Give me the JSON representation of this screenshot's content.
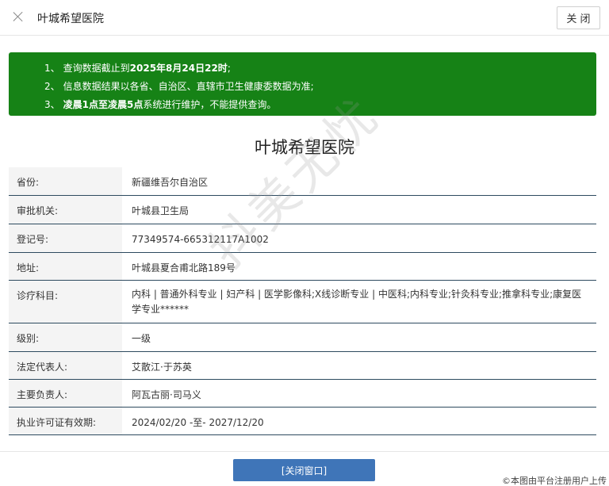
{
  "header": {
    "title": "叶城希望医院",
    "close_label": "关 闭",
    "close_icon": "close-x-icon"
  },
  "notice": {
    "items": [
      {
        "num": "1、",
        "pre": "查询数据截止到",
        "bold": "2025年8月24日22时",
        "post": ";"
      },
      {
        "num": "2、",
        "pre": "信息数据结果以各省、自治区、直辖市卫生健康委数据为准;",
        "bold": "",
        "post": ""
      },
      {
        "num": "3、",
        "pre": "",
        "bold": "凌晨1点至凌晨5点",
        "post": "系统进行维护，不能提供查询。"
      }
    ],
    "bg_color": "#168216"
  },
  "hospital_name": "叶城希望医院",
  "info": {
    "rows": [
      {
        "label": "省份:",
        "value": "新疆维吾尔自治区"
      },
      {
        "label": "审批机关:",
        "value": "叶城县卫生局"
      },
      {
        "label": "登记号:",
        "value": "77349574-665312117A1002"
      },
      {
        "label": "地址:",
        "value": "叶城县夏合甫北路189号"
      },
      {
        "label": "诊疗科目:",
        "value": "内科 | 普通外科专业 | 妇产科 | 医学影像科;X线诊断专业 | 中医科;内科专业;针灸科专业;推拿科专业;康复医学专业******"
      },
      {
        "label": "级别:",
        "value": "一级"
      },
      {
        "label": "法定代表人:",
        "value": "艾散江·于苏英"
      },
      {
        "label": "主要负责人:",
        "value": "阿瓦古丽·司马义"
      },
      {
        "label": "执业许可证有效期:",
        "value": "2024/02/20 -至- 2027/12/20"
      }
    ]
  },
  "footer": {
    "close_window_label": "[关闭窗口]",
    "watermark": "抖美无忧",
    "note": "©本图由平台注册用户上传"
  }
}
